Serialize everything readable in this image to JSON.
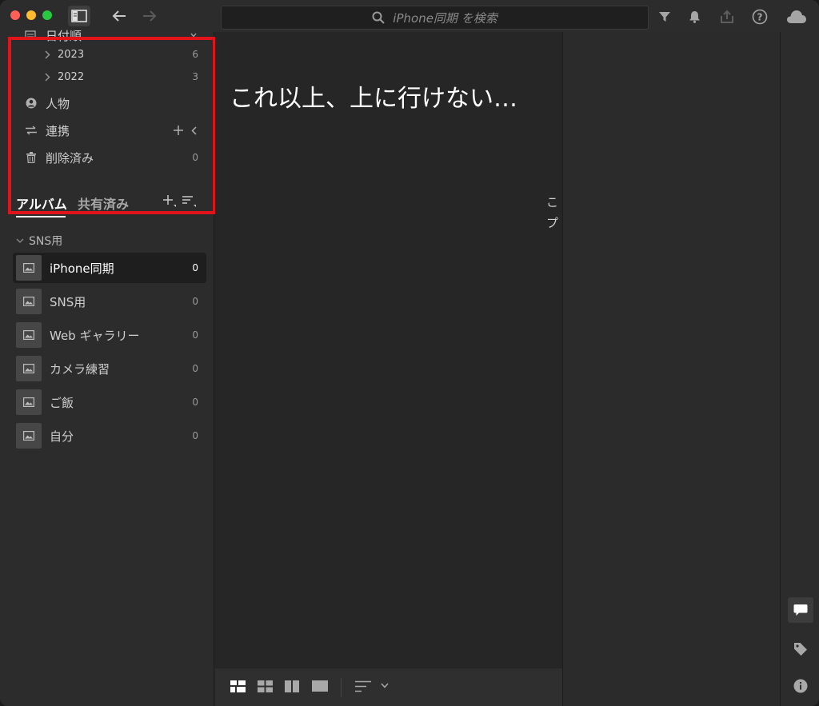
{
  "search": {
    "placeholder": "iPhone同期 を検索"
  },
  "tree": {
    "date_group": {
      "label": "日付順"
    },
    "years": [
      {
        "label": "2023",
        "count": "6"
      },
      {
        "label": "2022",
        "count": "3"
      }
    ],
    "people": {
      "label": "人物"
    },
    "connections": {
      "label": "連携"
    },
    "deleted": {
      "label": "削除済み",
      "count": "0"
    }
  },
  "tabs": {
    "albums": "アルバム",
    "shared": "共有済み"
  },
  "group": {
    "label": "SNS用"
  },
  "albums": [
    {
      "label": "iPhone同期",
      "count": "0"
    },
    {
      "label": "SNS用",
      "count": "0"
    },
    {
      "label": "Web ギャラリー",
      "count": "0"
    },
    {
      "label": "カメラ練習",
      "count": "0"
    },
    {
      "label": "ご飯",
      "count": "0"
    },
    {
      "label": "自分",
      "count": "0"
    }
  ],
  "main": {
    "message": "これ以上、上に行けない…",
    "cut_text_1": "こ",
    "cut_text_2": "プ"
  },
  "colors": {
    "highlight": "#e0141a",
    "background": "#262626"
  },
  "icons": {
    "traffic": [
      "close-icon",
      "minimize-icon",
      "zoom-icon"
    ],
    "toolbar": [
      "sidebar-toggle-icon",
      "back-arrow-icon",
      "forward-arrow-icon"
    ],
    "topright": [
      "filter-icon",
      "bell-icon",
      "share-icon",
      "help-icon",
      "cloud-icon"
    ],
    "rightstrip": [
      "comment-icon",
      "tag-icon",
      "info-icon"
    ]
  }
}
